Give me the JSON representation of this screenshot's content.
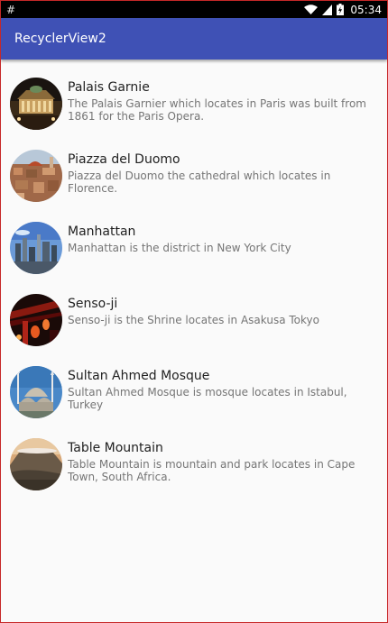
{
  "status_bar": {
    "left_glyph": "#",
    "time": "05:34",
    "icons": [
      "wifi-icon",
      "cell-signal-icon",
      "battery-icon"
    ]
  },
  "app_bar": {
    "title": "RecyclerView2",
    "color": "#3f51b5"
  },
  "places": [
    {
      "title": "Palais Garnie",
      "description": "The Palais Garnier which locates in Paris was built from 1861 for the Paris Opera.",
      "image": "palais-garnier-photo"
    },
    {
      "title": "Piazza del Duomo",
      "description": "Piazza del Duomo the cathedral which locates in Florence.",
      "image": "piazza-del-duomo-photo"
    },
    {
      "title": "Manhattan",
      "description": "Manhattan is the district in New York City",
      "image": "manhattan-photo"
    },
    {
      "title": "Senso-ji",
      "description": "Senso-ji is the Shrine locates in Asakusa Tokyo",
      "image": "senso-ji-photo"
    },
    {
      "title": "Sultan Ahmed Mosque",
      "description": "Sultan Ahmed Mosque is mosque locates in Istabul, Turkey",
      "image": "sultan-ahmed-mosque-photo"
    },
    {
      "title": "Table Mountain",
      "description": "Table Mountain is mountain and park locates in Cape Town, South Africa.",
      "image": "table-mountain-photo"
    }
  ]
}
